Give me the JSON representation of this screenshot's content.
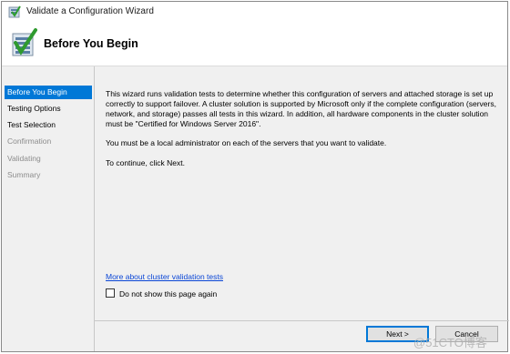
{
  "window": {
    "title": "Validate a Configuration Wizard"
  },
  "header": {
    "title": "Before You Begin"
  },
  "sidebar": {
    "items": [
      {
        "label": "Before You Begin",
        "state": "active"
      },
      {
        "label": "Testing Options",
        "state": "enabled"
      },
      {
        "label": "Test Selection",
        "state": "enabled"
      },
      {
        "label": "Confirmation",
        "state": "disabled"
      },
      {
        "label": "Validating",
        "state": "disabled"
      },
      {
        "label": "Summary",
        "state": "disabled"
      }
    ]
  },
  "main": {
    "paragraph1": "This wizard runs validation tests to determine whether this configuration of servers and attached storage is set up correctly to support failover. A cluster solution is supported by Microsoft only if the complete configuration (servers, network, and storage) passes all tests in this wizard. In addition, all hardware components in the cluster solution must be \"Certified for Windows Server 2016\".",
    "paragraph2": "You must be a local administrator on each of the servers that you want to validate.",
    "paragraph3": "To continue, click Next.",
    "link": "More about cluster validation tests",
    "checkbox_label": "Do not show this page again",
    "checkbox_checked": false
  },
  "buttons": {
    "next": "Next >",
    "cancel": "Cancel"
  },
  "watermark": "@51CTO博客",
  "colors": {
    "accent": "#0078d7",
    "link": "#0a46d6",
    "background": "#f0f0f0"
  }
}
